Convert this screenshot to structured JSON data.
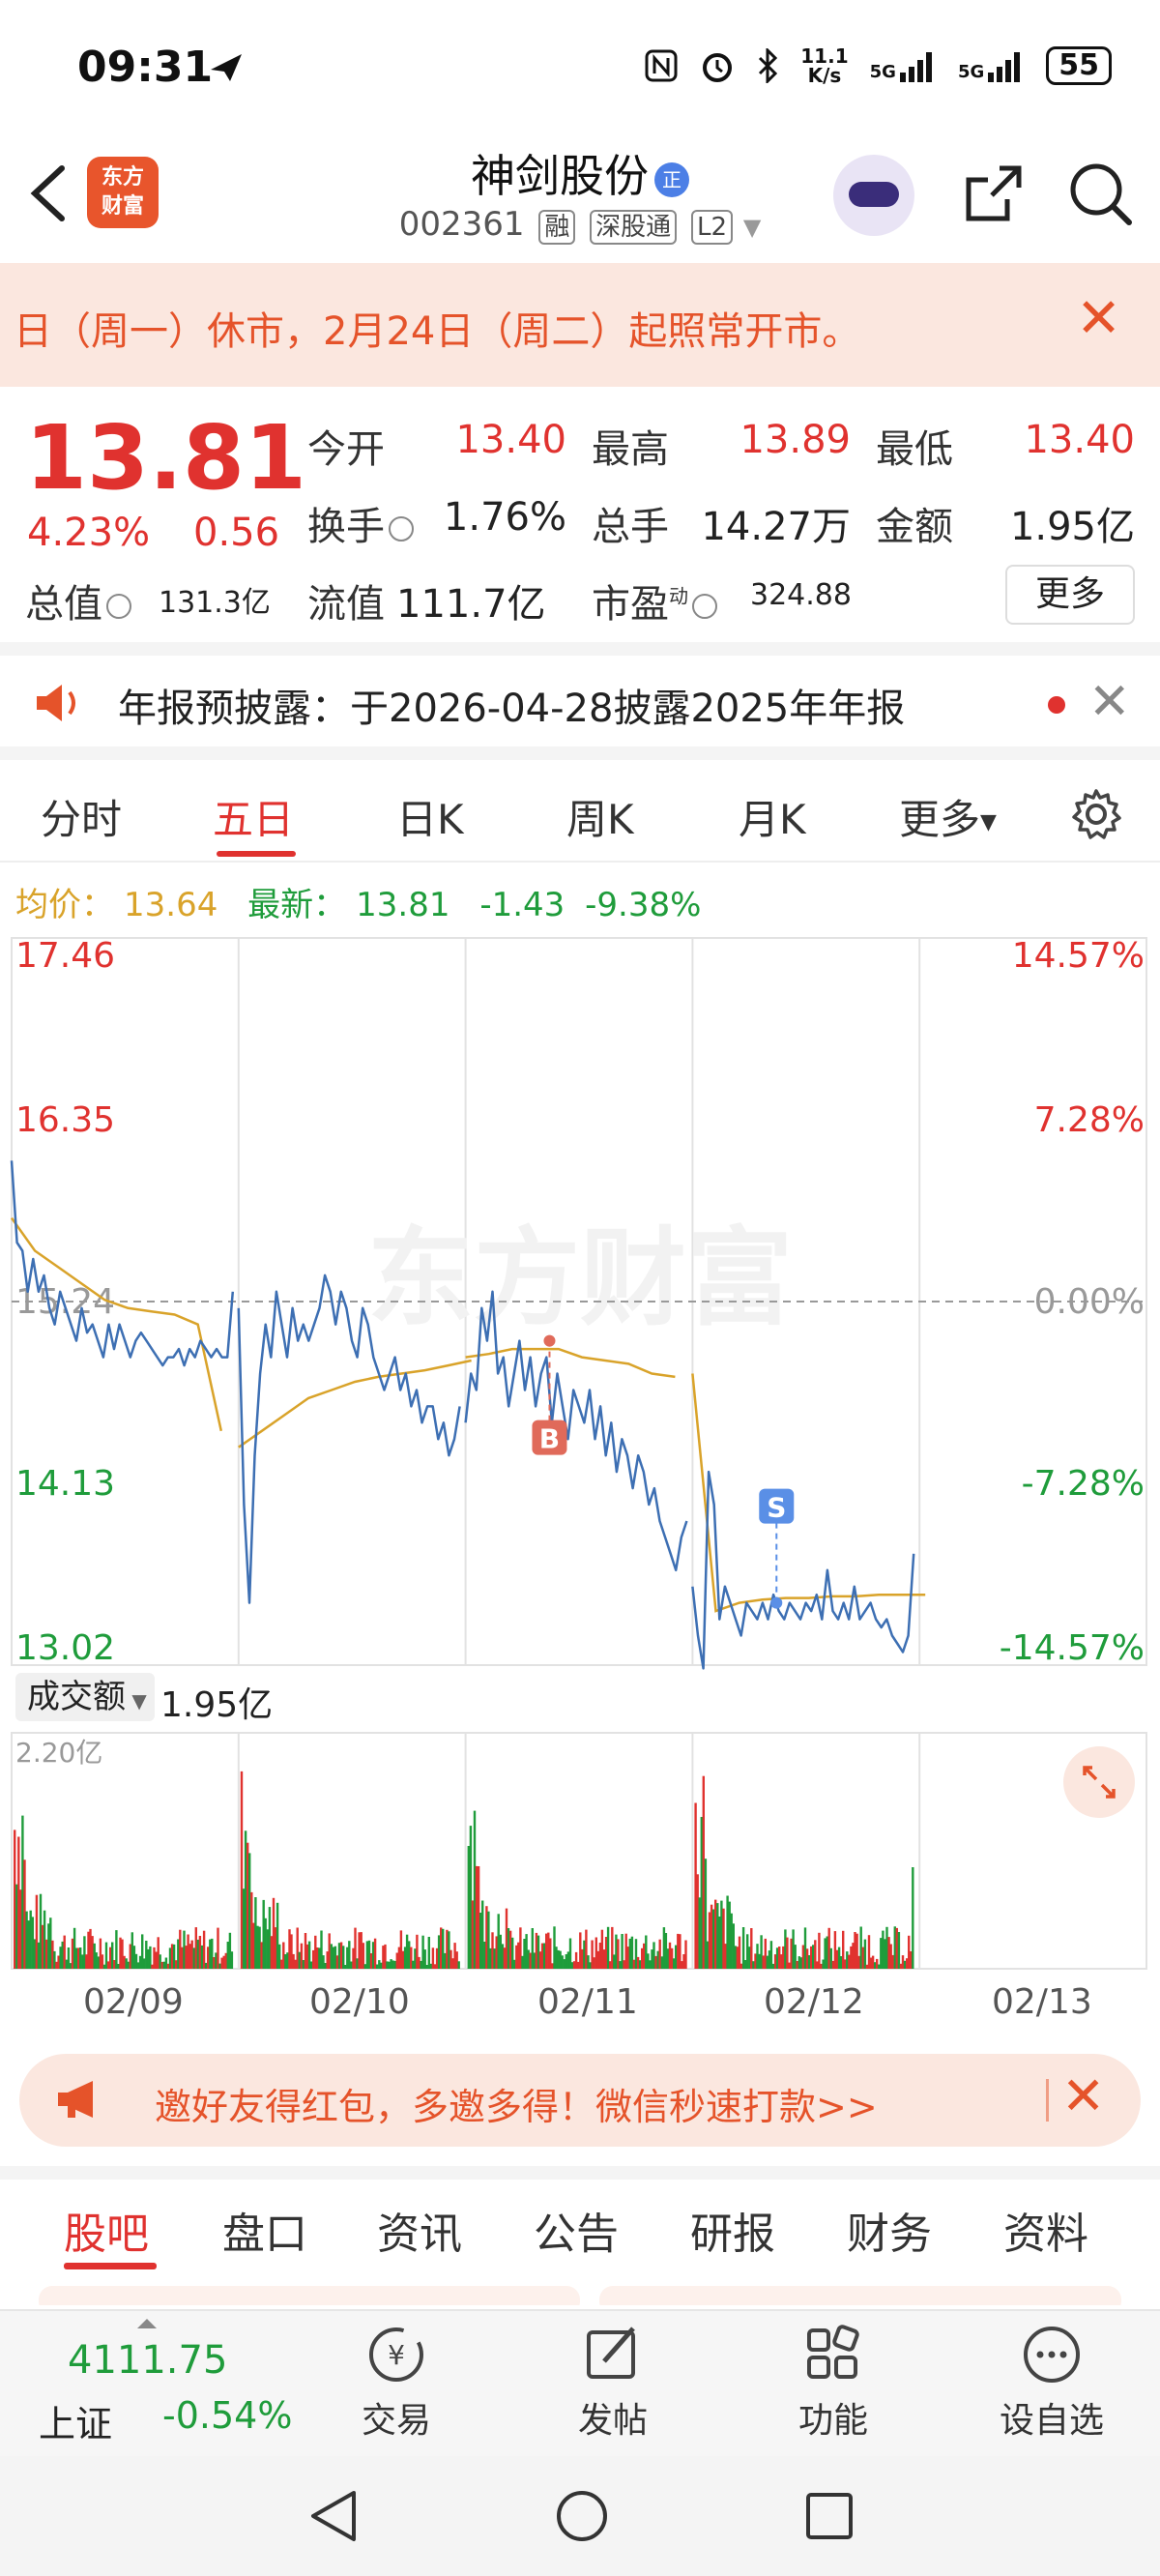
{
  "status_bar": {
    "time": "09:31",
    "net_speed_top": "11.1",
    "net_speed_bottom": "K/s",
    "signal1": "5G",
    "signal2": "5G",
    "battery": "55"
  },
  "header": {
    "logo_line1": "东方",
    "logo_line2": "财富",
    "stock_name": "神剑股份",
    "name_badge": "正",
    "stock_code": "002361",
    "tags": [
      "融",
      "深股通",
      "L2"
    ]
  },
  "notice": {
    "text": "日（周一）休市，2月24日（周二）起照常开市。"
  },
  "quote": {
    "price": "13.81",
    "change_pct": "4.23%",
    "change_val": "0.56",
    "open_label": "今开",
    "open": "13.40",
    "high_label": "最高",
    "high": "13.89",
    "low_label": "最低",
    "low": "13.40",
    "turnover_label": "换手",
    "turnover": "1.76%",
    "volume_label": "总手",
    "volume": "14.27万",
    "amount_label": "金额",
    "amount": "1.95亿",
    "mcap_label": "总值",
    "mcap": "131.3亿",
    "float_label": "流值",
    "float_cap": "111.7亿",
    "pe_label": "市盈",
    "pe_sup": "动",
    "pe": "324.88",
    "more": "更多"
  },
  "announcement": {
    "text": "年报预披露：于2026-04-28披露2025年年报"
  },
  "period_tabs": [
    "分时",
    "五日",
    "日K",
    "周K",
    "月K",
    "更多"
  ],
  "active_period": "五日",
  "summary": {
    "avg_label": "均价：",
    "avg": "13.64",
    "latest_label": "最新：",
    "latest": "13.81",
    "change": "-1.43",
    "change_pct": "-9.38%"
  },
  "chart_data": {
    "type": "line",
    "title": "",
    "xlabel": "",
    "ylabel": "",
    "ylim": [
      13.02,
      17.46
    ],
    "y_ticks_left": [
      "17.46",
      "16.35",
      "15.24",
      "14.13",
      "13.02"
    ],
    "y_ticks_right": [
      "14.57%",
      "7.28%",
      "0.00%",
      "-7.28%",
      "-14.57%"
    ],
    "x_tick_labels": [
      "02/09",
      "02/10",
      "02/11",
      "02/12",
      "02/13"
    ],
    "series": [
      {
        "values": [
          16.1,
          15.6,
          15.55,
          15.3,
          15.5,
          15.3,
          15.4,
          15.2,
          15.1,
          15.3,
          15.2,
          15.1,
          15.0,
          15.2,
          15.05,
          15.1,
          15.0,
          14.9,
          15.1,
          14.95,
          15.1,
          15.0,
          14.9,
          15.0,
          15.05,
          15.0,
          14.95,
          14.9,
          14.85,
          14.9,
          14.9,
          14.95,
          14.85,
          14.95,
          14.9,
          15.0,
          14.95,
          14.9,
          14.95,
          14.9,
          14.9,
          15.3
        ]
      },
      {
        "values": [
          15.2,
          14.0,
          13.4,
          14.3,
          14.8,
          15.1,
          14.9,
          15.3,
          15.1,
          14.9,
          15.2,
          15.0,
          15.1,
          15.0,
          15.1,
          15.2,
          15.4,
          15.3,
          15.1,
          15.3,
          15.2,
          15.0,
          14.9,
          15.2,
          15.1,
          14.9,
          14.8,
          14.7,
          14.8,
          14.9,
          14.7,
          14.8,
          14.6,
          14.7,
          14.5,
          14.6,
          14.6,
          14.4,
          14.5,
          14.3,
          14.4,
          14.6
        ]
      },
      {
        "values": [
          14.5,
          14.8,
          14.7,
          15.2,
          15.0,
          15.3,
          14.8,
          14.9,
          14.6,
          14.8,
          15.0,
          14.7,
          14.9,
          14.6,
          14.8,
          14.9,
          14.5,
          14.8,
          14.6,
          14.4,
          14.7,
          14.6,
          14.5,
          14.7,
          14.4,
          14.6,
          14.3,
          14.5,
          14.2,
          14.4,
          14.3,
          14.1,
          14.3,
          14.2,
          14.0,
          14.1,
          13.9,
          13.8,
          13.7,
          13.6,
          13.8,
          13.9
        ]
      },
      {
        "values": [
          13.5,
          13.2,
          13.0,
          14.2,
          14.0,
          13.3,
          13.5,
          13.4,
          13.3,
          13.2,
          13.4,
          13.35,
          13.3,
          13.4,
          13.3,
          13.45,
          13.35,
          13.3,
          13.4,
          13.35,
          13.3,
          13.4,
          13.35,
          13.45,
          13.3,
          13.6,
          13.35,
          13.3,
          13.4,
          13.3,
          13.5,
          13.3,
          13.35,
          13.4,
          13.3,
          13.25,
          13.3,
          13.2,
          13.15,
          13.1,
          13.2,
          13.7
        ]
      }
    ],
    "average_line_values": [
      15.75,
      15.55,
      15.45,
      15.35,
      15.25,
      15.2,
      15.18,
      15.16,
      15.1,
      14.45,
      14.35,
      14.45,
      14.55,
      14.65,
      14.7,
      14.75,
      14.78,
      14.8,
      14.82,
      14.85,
      14.88,
      14.9,
      14.92,
      14.95,
      14.95,
      14.95,
      14.9,
      14.88,
      14.86,
      14.8,
      14.78,
      14.8,
      13.35,
      13.4,
      13.42,
      13.43,
      13.43,
      13.44,
      13.44,
      13.45,
      13.45,
      13.45
    ],
    "markers": [
      {
        "label": "B",
        "day": "02/11",
        "price": 15.0,
        "color": "#e06a5a"
      },
      {
        "label": "S",
        "day": "02/12",
        "price": 13.4,
        "color": "#5a8fe6"
      }
    ],
    "watermark": "东方财富",
    "volume": {
      "label": "成交额",
      "value": "1.95亿",
      "y_max_label": "2.20亿"
    }
  },
  "invite": {
    "text": "邀好友得红包，多邀多得！微信秒速打款>>"
  },
  "bottom_tabs": [
    "股吧",
    "盘口",
    "资讯",
    "公告",
    "研报",
    "财务",
    "资料"
  ],
  "active_bottom_tab": "股吧",
  "toolbar": {
    "index_value": "4111.75",
    "index_name": "上证",
    "index_change": "-0.54%",
    "items": [
      "交易",
      "发帖",
      "功能",
      "设自选"
    ]
  },
  "colors": {
    "up": "#e0322f",
    "down": "#1f9c3b",
    "accent": "#e5532a",
    "avg_line": "#d9a32a",
    "price_line": "#3d6fb3"
  }
}
